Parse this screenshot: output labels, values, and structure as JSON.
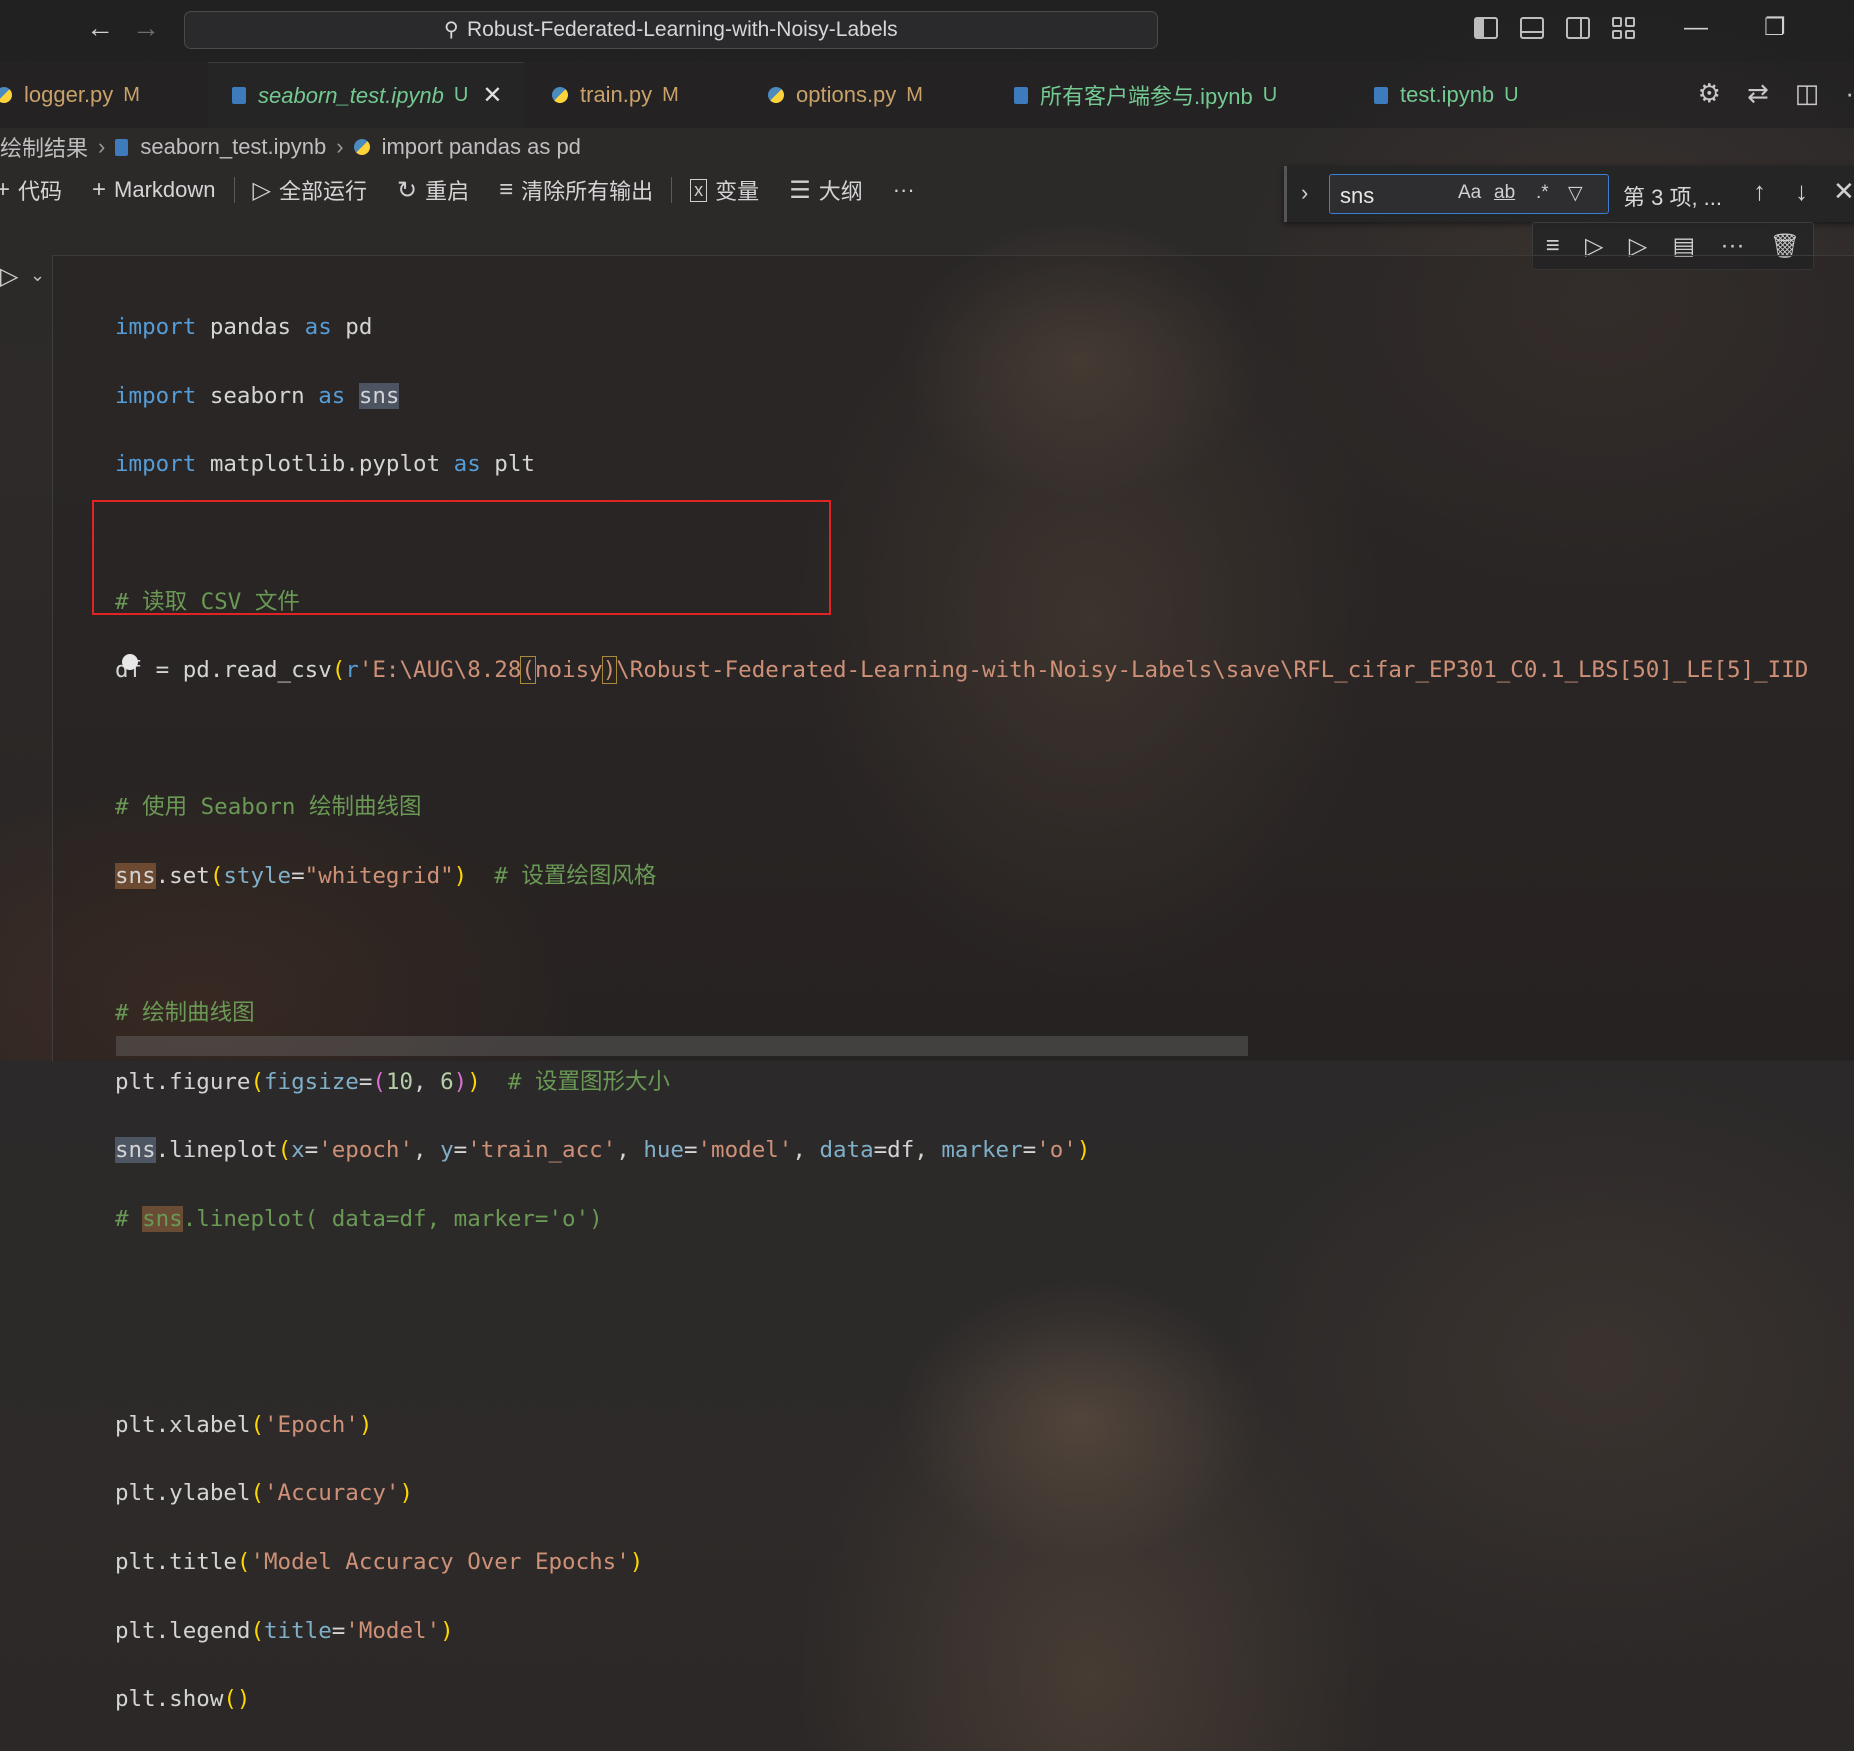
{
  "titlebar": {
    "back_icon": "arrow-left-icon",
    "forward_icon": "arrow-right-icon",
    "search_text": "Robust-Federated-Learning-with-Noisy-Labels"
  },
  "tabs": [
    {
      "label": "logger.py",
      "status": "M",
      "type": "python"
    },
    {
      "label": "seaborn_test.ipynb",
      "status": "U",
      "type": "notebook",
      "active": true
    },
    {
      "label": "train.py",
      "status": "M",
      "type": "python"
    },
    {
      "label": "options.py",
      "status": "M",
      "type": "python"
    },
    {
      "label": "所有客户端参与.ipynb",
      "status": "U",
      "type": "notebook"
    },
    {
      "label": "test.ipynb",
      "status": "U",
      "type": "notebook"
    }
  ],
  "breadcrumb": [
    "绘制结果",
    "seaborn_test.ipynb",
    "import pandas as pd"
  ],
  "notebook_toolbar": {
    "code": "代码",
    "markdown": "Markdown",
    "run_all": "全部运行",
    "restart": "重启",
    "clear_outputs": "清除所有输出",
    "variables": "变量",
    "outline": "大纲",
    "more": "···"
  },
  "find": {
    "query": "sns",
    "match_case": "Aa",
    "whole_word": "ab",
    "regex": ".*",
    "result": "第 3 项, ..."
  },
  "code": {
    "l1_import": "import",
    "l1_mod": " pandas ",
    "l1_as": "as",
    "l1_alias": " pd",
    "l2_import": "import",
    "l2_mod": " seaborn ",
    "l2_as": "as",
    "l2_alias": "sns",
    "l3_import": "import",
    "l3_mod": " matplotlib.pyplot ",
    "l3_as": "as",
    "l3_alias": " plt",
    "l5_comment": "# 读取 CSV 文件",
    "l6_a": "df = pd.read_csv",
    "l6_paren": "(",
    "l6_r": "r",
    "l6_str1": "'E:\\AUG\\8.28",
    "l6_p1": "(",
    "l6_noisy": "noisy",
    "l6_p2": ")",
    "l6_str2": "\\Robust-Federated-Learning-with-Noisy-Labels\\save\\RFL_cifar_EP301_C0.1_LBS[50]_LE[5]_IID",
    "l8_comment": "# 使用 Seaborn 绘制曲线图",
    "l9_sns": "sns",
    "l9_call": ".set",
    "l9_paren": "(",
    "l9_param": "style",
    "l9_eq": "=",
    "l9_val": "\"whitegrid\"",
    "l9_close": ")",
    "l9_comment": "  # 设置绘图风格",
    "l11_comment": "# 绘制曲线图",
    "l12_a": "plt.figure",
    "l12_paren": "(",
    "l12_param": "figsize",
    "l12_eq": "=",
    "l12_tp": "(",
    "l12_n1": "10",
    "l12_comma": ", ",
    "l12_n2": "6",
    "l12_tc": ")",
    "l12_close": ")",
    "l12_comment": "  # 设置图形大小",
    "l13_sns": "sns",
    "l13_call": ".lineplot",
    "l13_paren": "(",
    "l13_x": "x",
    "l13_xv": "'epoch'",
    "l13_y": "y",
    "l13_yv": "'train_acc'",
    "l13_hue": "hue",
    "l13_huev": "'model'",
    "l13_data": "data",
    "l13_datav": "df",
    "l13_marker": "marker",
    "l13_markerv": "'o'",
    "l13_close": ")",
    "l14_hash": "# ",
    "l14_sns": "sns",
    "l14_rest": ".lineplot( data=df, marker='o')",
    "l17_a": "plt.xlabel",
    "l17_s": "'Epoch'",
    "l18_a": "plt.ylabel",
    "l18_s": "'Accuracy'",
    "l19_a": "plt.title",
    "l19_s": "'Model Accuracy Over Epochs'",
    "l20_a": "plt.legend",
    "l20_p": "title",
    "l20_s": "'Model'",
    "l21_a": "plt.show",
    "l21_p": "()"
  },
  "colors": {
    "keyword": "#569cd6",
    "comment": "#6a9955",
    "string": "#ce9178",
    "number": "#b5cea8",
    "highlight_box": "#e02424",
    "modified": "#c8a26a",
    "untracked": "#73c991"
  }
}
